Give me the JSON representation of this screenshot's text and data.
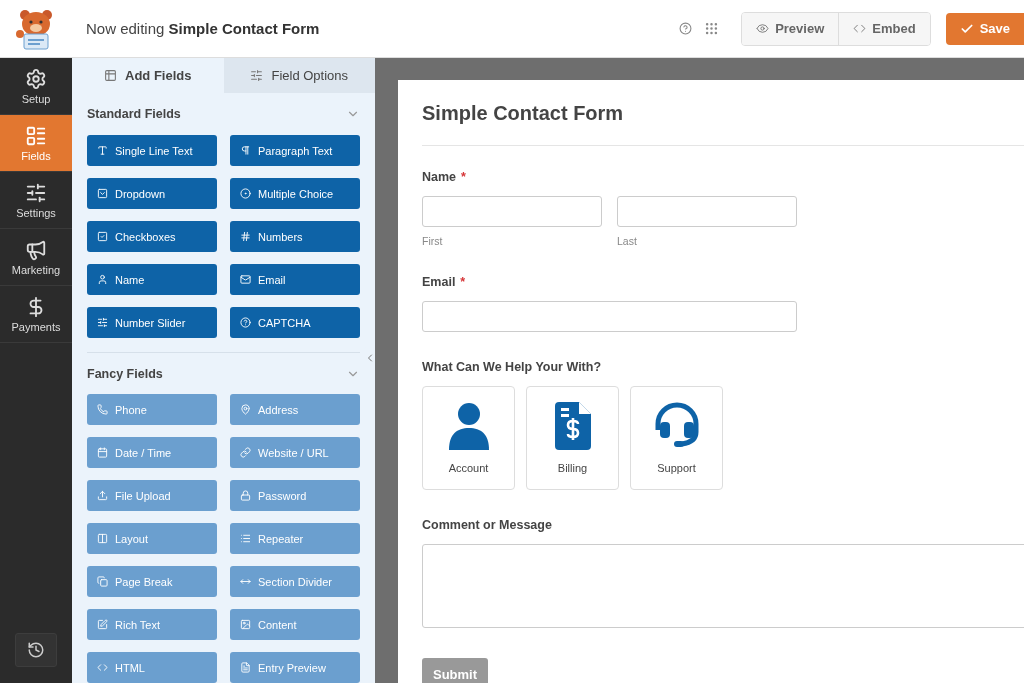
{
  "header": {
    "prefix": "Now editing",
    "form_name": "Simple Contact Form",
    "buttons": [
      {
        "kind": "preview",
        "label": "Preview"
      },
      {
        "kind": "embed",
        "label": "Embed"
      },
      {
        "kind": "save",
        "label": "Save"
      }
    ]
  },
  "nav": [
    {
      "label": "Setup",
      "selected": false
    },
    {
      "label": "Fields",
      "selected": true
    },
    {
      "label": "Settings",
      "selected": false
    },
    {
      "label": "Marketing",
      "selected": false
    },
    {
      "label": "Payments",
      "selected": false
    }
  ],
  "panel": {
    "tabs": [
      {
        "label": "Add Fields",
        "selected": true
      },
      {
        "label": "Field Options",
        "selected": false
      }
    ],
    "sections": [
      {
        "kind": "standard",
        "title": "Standard Fields",
        "fields": [
          "Single Line Text",
          "Paragraph Text",
          "Dropdown",
          "Multiple Choice",
          "Checkboxes",
          "Numbers",
          "Name",
          "Email",
          "Number Slider",
          "CAPTCHA"
        ]
      },
      {
        "kind": "fancy",
        "title": "Fancy Fields",
        "fields": [
          "Phone",
          "Address",
          "Date / Time",
          "Website / URL",
          "File Upload",
          "Password",
          "Layout",
          "Repeater",
          "Page Break",
          "Section Divider",
          "Rich Text",
          "Content",
          "HTML",
          "Entry Preview"
        ]
      }
    ]
  },
  "form": {
    "title": "Simple Contact Form",
    "fields": [
      {
        "kind": "name",
        "label": "Name",
        "required_mark": "*",
        "sublabels": [
          "First",
          "Last"
        ]
      },
      {
        "kind": "email",
        "label": "Email",
        "required_mark": "*"
      },
      {
        "kind": "icon_choices",
        "label": "What Can We Help Your With?",
        "choices": [
          "Account",
          "Billing",
          "Support"
        ]
      },
      {
        "kind": "textarea",
        "label": "Comment or Message"
      }
    ],
    "submit": "Submit"
  }
}
